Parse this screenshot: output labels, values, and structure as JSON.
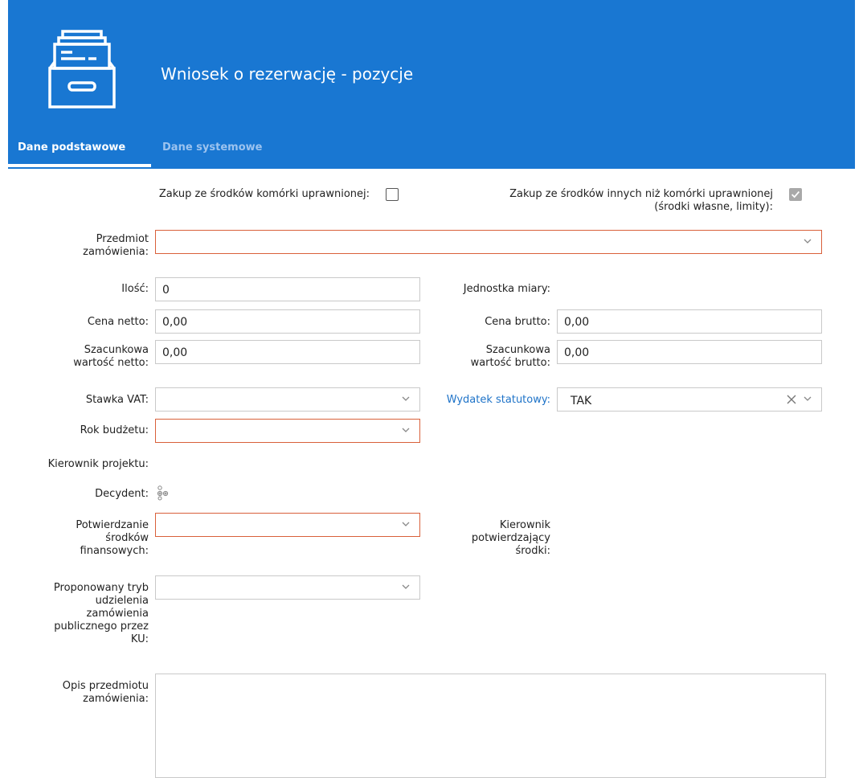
{
  "header": {
    "title": "Wniosek o rezerwację - pozycje",
    "icon": "file-cabinet-icon",
    "background": "#1977d2"
  },
  "tabs": [
    {
      "label": "Dane podstawowe",
      "active": true
    },
    {
      "label": "Dane systemowe",
      "active": false
    }
  ],
  "form": {
    "zakup_komorki": {
      "label": "Zakup ze środków komórki uprawnionej:",
      "checked": false
    },
    "zakup_inne": {
      "label_line1": "Zakup ze środków innych niż komórki uprawnionej",
      "label_line2": "(środki własne, limity):",
      "checked": true
    },
    "przedmiot": {
      "label_line1": "Przedmiot",
      "label_line2": "zamówienia:",
      "value": ""
    },
    "ilosc": {
      "label": "Ilość:",
      "value": "0"
    },
    "jednostka": {
      "label": "Jednostka miary:"
    },
    "cena_netto": {
      "label": "Cena netto:",
      "value": "0,00"
    },
    "cena_brutto": {
      "label": "Cena brutto:",
      "value": "0,00"
    },
    "szac_netto": {
      "label_line1": "Szacunkowa",
      "label_line2": "wartość netto:",
      "value": "0,00"
    },
    "szac_brutto": {
      "label_line1": "Szacunkowa",
      "label_line2": "wartość brutto:",
      "value": "0,00"
    },
    "stawka_vat": {
      "label": "Stawka VAT:",
      "value": ""
    },
    "wydatek": {
      "label": "Wydatek statutowy:",
      "value": "TAK"
    },
    "rok": {
      "label": "Rok budżetu:",
      "value": ""
    },
    "kierownik_projektu": {
      "label": "Kierownik projektu:"
    },
    "decydent": {
      "label": "Decydent:",
      "icon": "people-group-icon"
    },
    "potwierdzanie": {
      "label_line1": "Potwierdzanie",
      "label_line2": "środków",
      "label_line3": "finansowych:",
      "value": ""
    },
    "kierownik_potw": {
      "label_line1": "Kierownik",
      "label_line2": "potwierdzający",
      "label_line3": "środki:"
    },
    "tryb": {
      "label_line1": "Proponowany tryb",
      "label_line2": "udzielenia",
      "label_line3": "zamówienia",
      "label_line4": "publicznego przez",
      "label_line5": "KU:",
      "value": ""
    },
    "opis": {
      "label_line1": "Opis przedmiotu",
      "label_line2": "zamówienia:",
      "value": ""
    }
  }
}
